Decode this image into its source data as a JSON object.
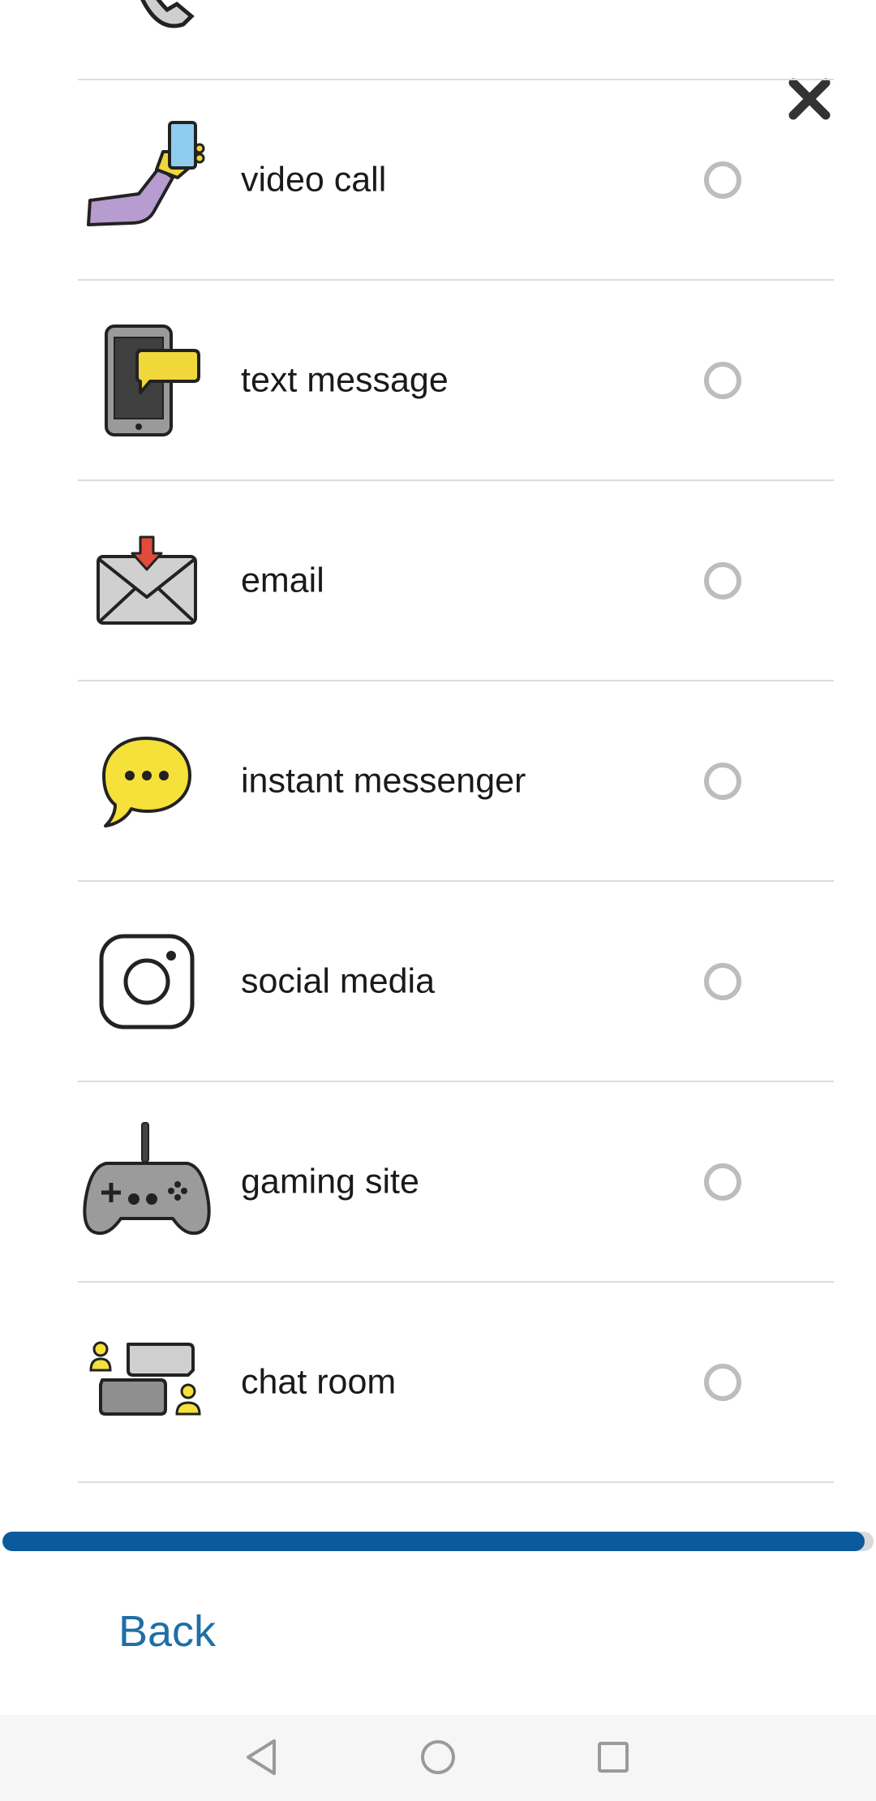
{
  "options": [
    {
      "label": "",
      "icon": "phone-call-icon"
    },
    {
      "label": "video call",
      "icon": "video-call-icon"
    },
    {
      "label": "text message",
      "icon": "text-message-icon"
    },
    {
      "label": "email",
      "icon": "email-icon"
    },
    {
      "label": "instant messenger",
      "icon": "instant-messenger-icon"
    },
    {
      "label": "social media",
      "icon": "social-media-icon"
    },
    {
      "label": "gaming site",
      "icon": "gaming-site-icon"
    },
    {
      "label": "chat room",
      "icon": "chat-room-icon"
    }
  ],
  "progress": 0.99,
  "back_label": "Back",
  "colors": {
    "accent": "#0a5a9c",
    "link": "#1f6fa6",
    "radio": "#bdbdbd"
  }
}
